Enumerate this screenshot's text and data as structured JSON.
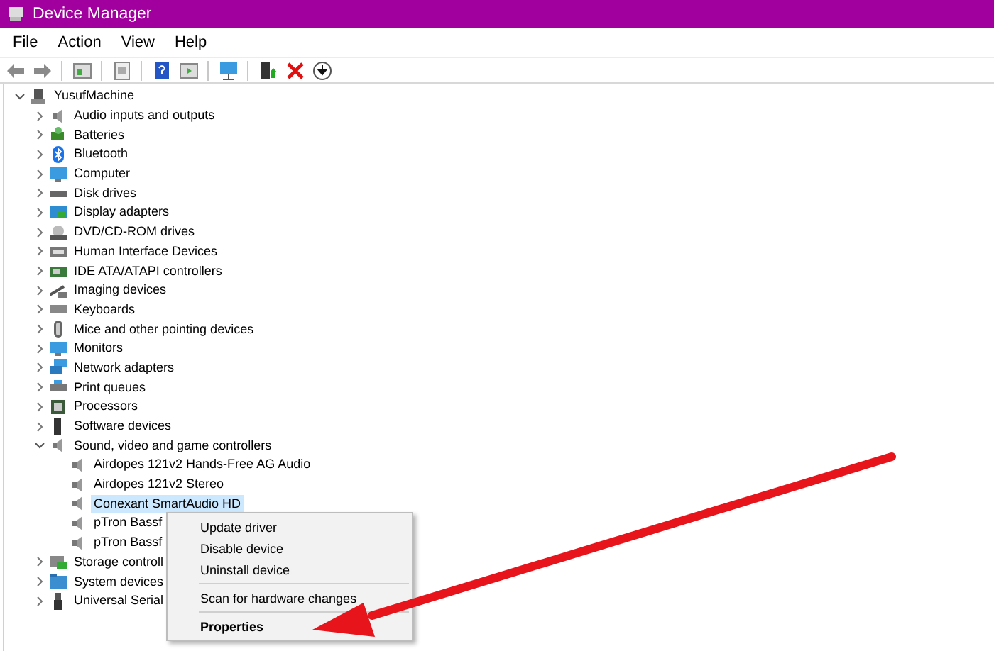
{
  "window": {
    "title": "Device Manager"
  },
  "menu": [
    "File",
    "Action",
    "View",
    "Help"
  ],
  "toolbar": [
    {
      "kind": "back",
      "disabled": false
    },
    {
      "kind": "forward",
      "disabled": false
    },
    {
      "kind": "separator"
    },
    {
      "kind": "tree",
      "disabled": false
    },
    {
      "kind": "separator"
    },
    {
      "kind": "properties",
      "disabled": false
    },
    {
      "kind": "separator"
    },
    {
      "kind": "help",
      "disabled": false
    },
    {
      "kind": "pane",
      "disabled": false
    },
    {
      "kind": "separator"
    },
    {
      "kind": "scan",
      "disabled": false
    },
    {
      "kind": "separator"
    },
    {
      "kind": "update",
      "disabled": false
    },
    {
      "kind": "uninstall",
      "disabled": false
    },
    {
      "kind": "download",
      "disabled": false
    }
  ],
  "tree": {
    "label": "YusufMachine",
    "kind": "computer",
    "expanded": true,
    "selected": false,
    "children": [
      {
        "label": "Audio inputs and outputs",
        "kind": "speaker",
        "expanded": false,
        "selected": false
      },
      {
        "label": "Batteries",
        "kind": "battery",
        "expanded": false,
        "selected": false
      },
      {
        "label": "Bluetooth",
        "kind": "bluetooth",
        "expanded": false,
        "selected": false
      },
      {
        "label": "Computer",
        "kind": "monitor",
        "expanded": false,
        "selected": false
      },
      {
        "label": "Disk drives",
        "kind": "disk",
        "expanded": false,
        "selected": false
      },
      {
        "label": "Display adapters",
        "kind": "display",
        "expanded": false,
        "selected": false
      },
      {
        "label": "DVD/CD-ROM drives",
        "kind": "dvd",
        "expanded": false,
        "selected": false
      },
      {
        "label": "Human Interface Devices",
        "kind": "hid",
        "expanded": false,
        "selected": false
      },
      {
        "label": "IDE ATA/ATAPI controllers",
        "kind": "chip",
        "expanded": false,
        "selected": false
      },
      {
        "label": "Imaging devices",
        "kind": "camera",
        "expanded": false,
        "selected": false
      },
      {
        "label": "Keyboards",
        "kind": "keyboard",
        "expanded": false,
        "selected": false
      },
      {
        "label": "Mice and other pointing devices",
        "kind": "mouse",
        "expanded": false,
        "selected": false
      },
      {
        "label": "Monitors",
        "kind": "monitor",
        "expanded": false,
        "selected": false
      },
      {
        "label": "Network adapters",
        "kind": "network",
        "expanded": false,
        "selected": false
      },
      {
        "label": "Print queues",
        "kind": "printer",
        "expanded": false,
        "selected": false
      },
      {
        "label": "Processors",
        "kind": "processor",
        "expanded": false,
        "selected": false
      },
      {
        "label": "Software devices",
        "kind": "software",
        "expanded": false,
        "selected": false
      },
      {
        "label": "Sound, video and game controllers",
        "kind": "speaker",
        "expanded": true,
        "selected": false,
        "children": [
          {
            "label": "Airdopes 121v2 Hands-Free AG Audio",
            "kind": "speaker",
            "selected": false
          },
          {
            "label": "Airdopes 121v2 Stereo",
            "kind": "speaker",
            "selected": false
          },
          {
            "label": "Conexant SmartAudio HD",
            "kind": "speaker",
            "selected": true
          },
          {
            "label": "pTron Bassf",
            "kind": "speaker",
            "selected": false
          },
          {
            "label": "pTron Bassf",
            "kind": "speaker",
            "selected": false
          }
        ]
      },
      {
        "label": "Storage controll",
        "kind": "storage",
        "expanded": false,
        "selected": false
      },
      {
        "label": "System devices",
        "kind": "folder",
        "expanded": false,
        "selected": false
      },
      {
        "label": "Universal Serial",
        "kind": "usb",
        "expanded": false,
        "selected": false
      }
    ]
  },
  "context_menu": {
    "groups": [
      [
        {
          "label": "Update driver",
          "default": false
        },
        {
          "label": "Disable device",
          "default": false
        },
        {
          "label": "Uninstall device",
          "default": false
        }
      ],
      [
        {
          "label": "Scan for hardware changes",
          "default": false
        }
      ],
      [
        {
          "label": "Properties",
          "default": true
        }
      ]
    ]
  }
}
